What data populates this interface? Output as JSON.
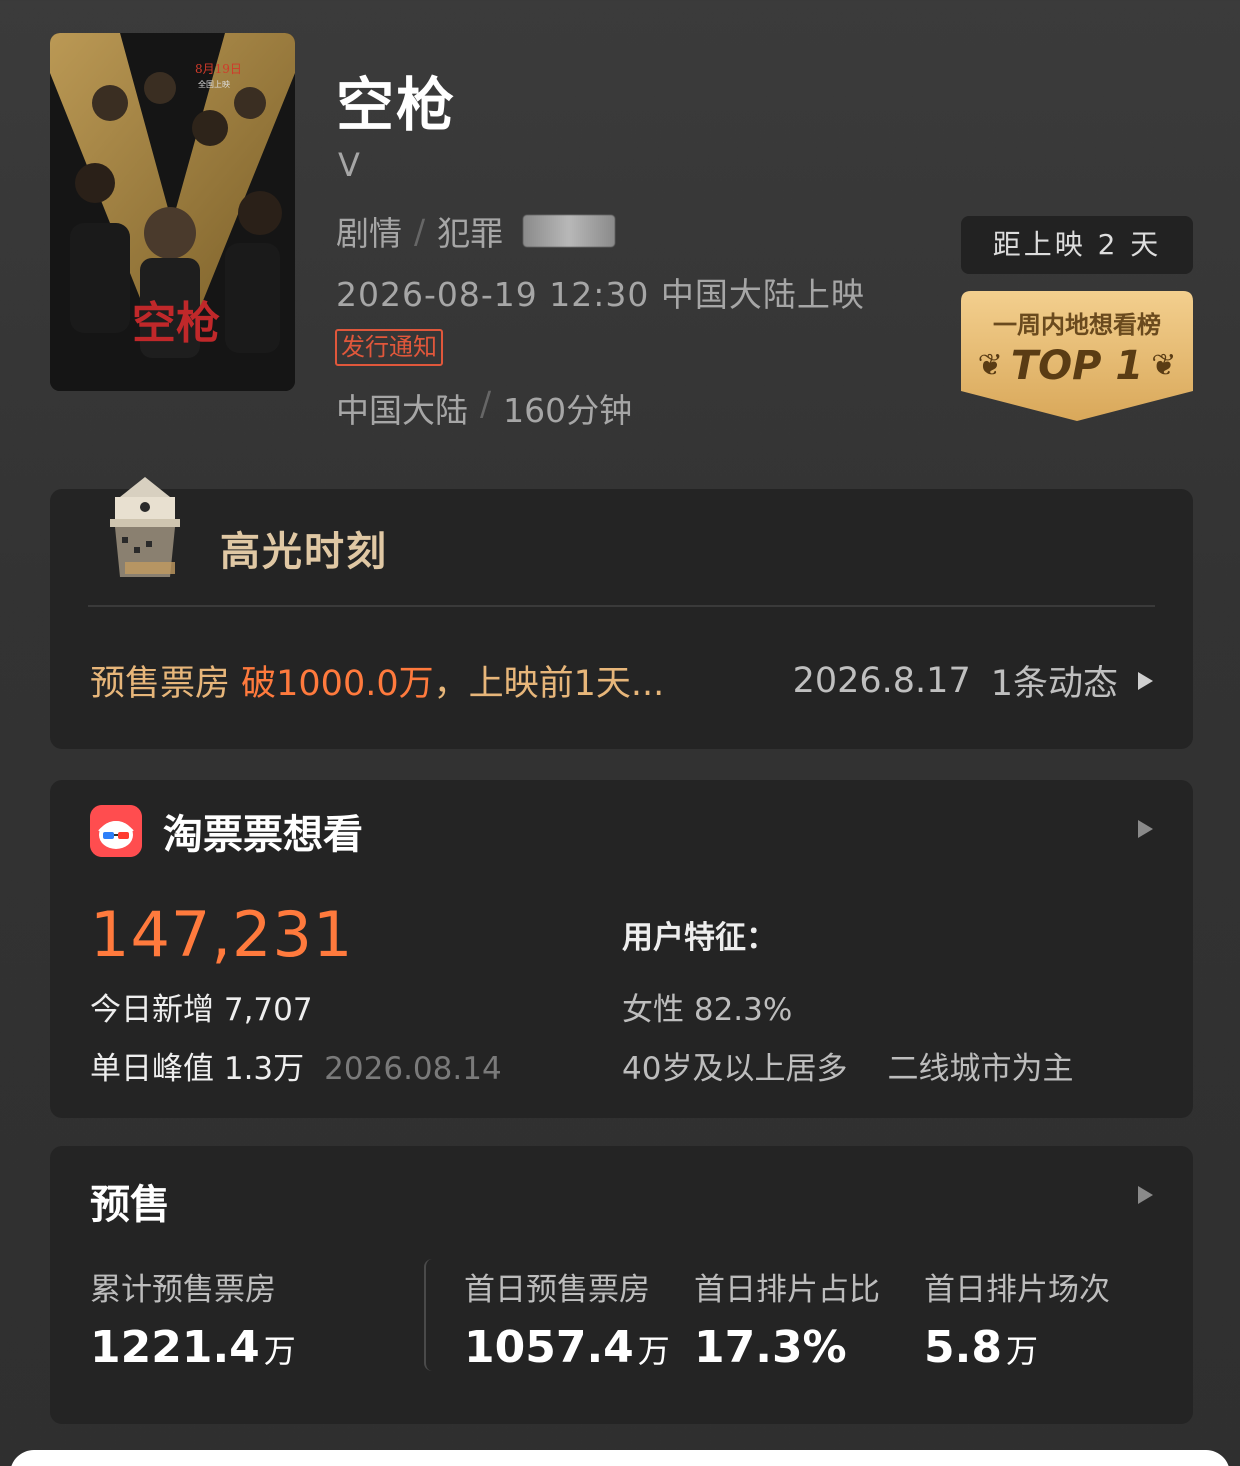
{
  "movie": {
    "title": "空枪",
    "subtitle": "V",
    "genres": [
      "剧情",
      "犯罪"
    ],
    "release": "2026-08-19 12:30 中国大陆上映",
    "notice_tag": "发行通知",
    "region": "中国大陆",
    "duration": "160分钟",
    "poster": {
      "date_text": "8月19日",
      "sub_text": "全国上映",
      "title_text": "空枪"
    }
  },
  "countdown": "距上映 2 天",
  "rank": {
    "title": "一周内地想看榜",
    "top": "TOP 1"
  },
  "highlight": {
    "title": "高光时刻",
    "text_prefix": "预售票房 ",
    "text_accent": "破1000.0万",
    "text_suffix": "，上映前1天...",
    "date": "2026.8.17",
    "count": "1条动态"
  },
  "wish": {
    "title": "淘票票想看",
    "total": "147,231",
    "new_today_label": "今日新增",
    "new_today": "7,707",
    "peak_label": "单日峰值",
    "peak": "1.3万",
    "peak_date": "2026.08.14",
    "user_title": "用户特征：",
    "female": "女性 82.3%",
    "age": "40岁及以上居多",
    "city": "二线城市为主"
  },
  "presale": {
    "title": "预售",
    "stats": [
      {
        "label": "累计预售票房",
        "value": "1221.4",
        "unit": "万"
      },
      {
        "label": "首日预售票房",
        "value": "1057.4",
        "unit": "万"
      },
      {
        "label": "首日排片占比",
        "value": "17.3%",
        "unit": ""
      },
      {
        "label": "首日排片场次",
        "value": "5.8",
        "unit": "万"
      }
    ]
  },
  "colors": {
    "accent_orange": "#ff7a3d",
    "gold": "#e7b67a",
    "notice_red": "#e0573b"
  }
}
